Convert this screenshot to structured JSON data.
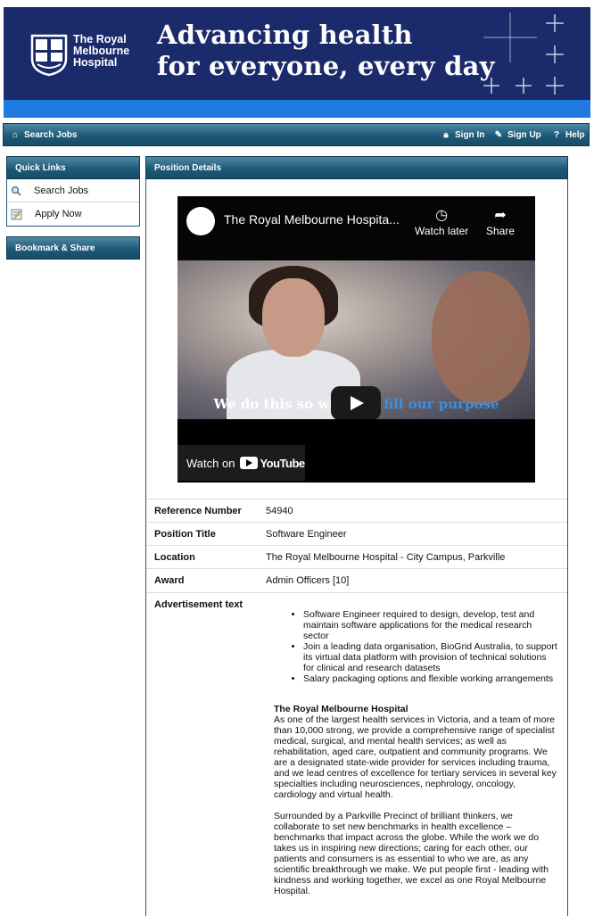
{
  "banner": {
    "logo_lines": [
      "The Royal",
      "Melbourne",
      "Hospital"
    ],
    "headline_line1": "Advancing health",
    "headline_line2": "for everyone, every day",
    "colors": {
      "navy": "#1b2a6b",
      "strip": "#1f7ae0"
    }
  },
  "nav": {
    "search_jobs": "Search Jobs",
    "sign_in": "Sign In",
    "sign_up": "Sign Up",
    "help": "Help",
    "icons": {
      "search_jobs": "home-icon",
      "sign_in": "lock-icon",
      "sign_up": "pencil-icon",
      "help": "question-icon"
    }
  },
  "quick_links": {
    "title": "Quick Links",
    "items": [
      {
        "label": "Search Jobs",
        "icon": "magnifier-icon"
      },
      {
        "label": "Apply Now",
        "icon": "form-icon"
      }
    ]
  },
  "bookmark": {
    "title": "Bookmark & Share"
  },
  "position": {
    "title": "Position Details",
    "video": {
      "channel_title": "The Royal Melbourne Hospita...",
      "watch_later": "Watch later",
      "share": "Share",
      "caption_white": "We do this so we e",
      "caption_blue": "fill our purpose",
      "watch_on": "Watch on",
      "youtube": "YouTube"
    },
    "fields": [
      {
        "label": "Reference Number",
        "value": "54940"
      },
      {
        "label": "Position Title",
        "value": "Software Engineer"
      },
      {
        "label": "Location",
        "value": "The Royal Melbourne Hospital - City Campus, Parkville"
      },
      {
        "label": "Award",
        "value": "Admin Officers [10]"
      }
    ],
    "ad_label": "Advertisement text",
    "bullets": [
      "Software Engineer required to design, develop, test and maintain software applications for the medical research sector",
      "Join a leading data organisation, BioGrid Australia, to support its virtual data platform with provision of technical solutions for clinical and research datasets",
      "Salary packaging options and flexible working arrangements"
    ],
    "org_heading": "The Royal Melbourne Hospital",
    "paragraph1": "As one of the largest health services in Victoria, and a team of more than 10,000 strong, we provide a comprehensive range of specialist medical, surgical, and mental health services; as well as rehabilitation, aged care, outpatient and community programs. We are a designated state-wide provider for services including trauma, and we lead centres of excellence for tertiary services in several key specialties including neurosciences, nephrology, oncology, cardiology and virtual health.",
    "paragraph2": "Surrounded by a Parkville Precinct of brilliant thinkers, we collaborate to set new benchmarks in health excellence – benchmarks that impact across the globe. While the work we do takes us in inspiring new directions; caring for each other, our patients and consumers is as essential to who we are, as any scientific breakthrough we make. We put people first - leading with kindness and working together, we excel as one Royal Melbourne Hospital."
  }
}
